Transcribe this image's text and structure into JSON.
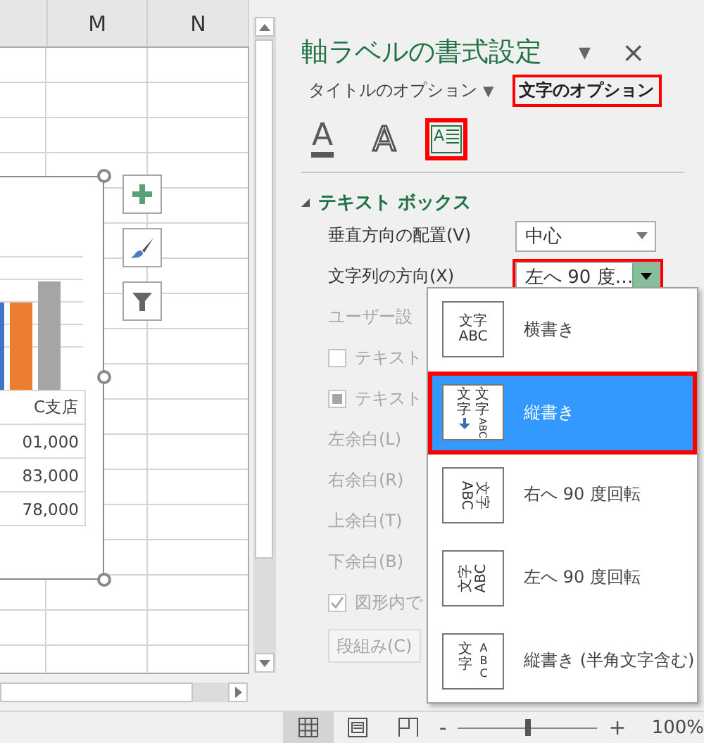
{
  "sheet": {
    "columns": [
      {
        "label": "M"
      },
      {
        "label": "N"
      }
    ],
    "chart": {
      "table_cells": [
        "C支店",
        "01,000",
        "83,000",
        "78,000"
      ],
      "buttons": [
        {
          "kind": "add"
        },
        {
          "kind": "style"
        },
        {
          "kind": "filter"
        }
      ]
    }
  },
  "pane": {
    "title": "軸ラベルの書式設定",
    "menu_glyph": "▼",
    "close_glyph": "×",
    "tabs": [
      {
        "label": "タイトルのオプション",
        "selected": false,
        "highlighted": false,
        "menu_glyph": "▼"
      },
      {
        "label": "文字のオプション",
        "selected": true,
        "highlighted": true
      }
    ],
    "icon_tabs": [
      {
        "kind": "fill",
        "glyph": "A",
        "highlighted": false
      },
      {
        "kind": "outline",
        "glyph": "A",
        "highlighted": false
      },
      {
        "kind": "textbox",
        "glyph": "A",
        "highlighted": true
      }
    ],
    "section": {
      "label": "テキスト ボックス",
      "expanded": true
    },
    "fields": [
      {
        "kind": "dropdown",
        "label": "垂直方向の配置(V)",
        "value": "中心",
        "disabled": false,
        "highlighted": false,
        "open": false
      },
      {
        "kind": "dropdown",
        "label": "文字列の方向(X)",
        "value": "左へ 90 度…",
        "disabled": false,
        "highlighted": true,
        "open": true
      },
      {
        "kind": "text",
        "label": "ユーザー設",
        "disabled": true
      },
      {
        "kind": "checkbox",
        "label": "テキスト",
        "checked": false,
        "disabled": true
      },
      {
        "kind": "checkbox",
        "label": "テキスト",
        "checked": false,
        "mixed": true,
        "disabled": true
      },
      {
        "kind": "text",
        "label": "左余白(L)",
        "disabled": true
      },
      {
        "kind": "text",
        "label": "右余白(R)",
        "disabled": true
      },
      {
        "kind": "text",
        "label": "上余白(T)",
        "disabled": true
      },
      {
        "kind": "text",
        "label": "下余白(B)",
        "disabled": true
      },
      {
        "kind": "checkbox",
        "label": "図形内で",
        "checked": true,
        "disabled": true
      },
      {
        "kind": "button",
        "label": "段組み(C)",
        "disabled": true
      }
    ]
  },
  "dropdown_menu": {
    "items": [
      {
        "label": "横書き",
        "kind": "horizontal",
        "icon_lines": [
          "文字",
          "ABC"
        ],
        "selected": false,
        "highlighted": false
      },
      {
        "label": "縦書き",
        "kind": "vertical",
        "icon_lines": [
          "文字",
          "文字",
          "ABC"
        ],
        "selected": true,
        "highlighted": true
      },
      {
        "label": "右へ 90 度回転",
        "kind": "rotate_right",
        "icon_lines": [
          "文字",
          "ABC"
        ],
        "selected": false,
        "highlighted": false
      },
      {
        "label": "左へ 90 度回転",
        "kind": "rotate_left",
        "icon_lines": [
          "文字",
          "ABC"
        ],
        "selected": false,
        "highlighted": false
      },
      {
        "label": "縦書き (半角文字含む)",
        "kind": "stacked",
        "icon_lines": [
          "文字",
          "ABC"
        ],
        "selected": false,
        "highlighted": false
      }
    ]
  },
  "status_bar": {
    "views": [
      {
        "kind": "normal",
        "selected": true
      },
      {
        "kind": "page_layout",
        "selected": false
      },
      {
        "kind": "page_break",
        "selected": false
      }
    ],
    "zoom_out": "-",
    "zoom": {
      "level": 0.5
    },
    "zoom_in": "+",
    "zoom_reading": "100%"
  }
}
